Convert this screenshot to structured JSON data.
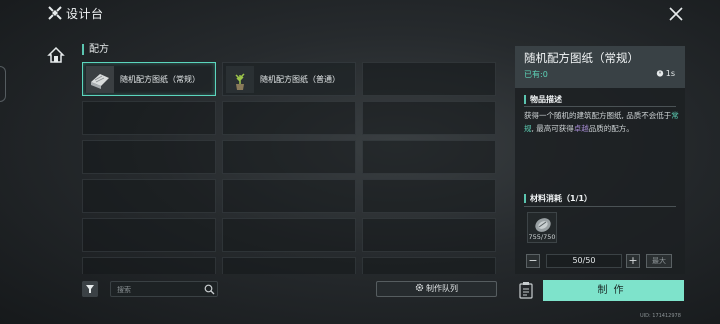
{
  "header": {
    "title": "设计台",
    "logo_icon": "crossed-tools-icon",
    "close_icon": "close-icon"
  },
  "nav": {
    "home_icon": "house-icon"
  },
  "section": {
    "title": "配方"
  },
  "recipes": [
    {
      "label": "随机配方图纸（常规）",
      "selected": true,
      "icon": "blueprint-icon"
    },
    {
      "label": "随机配方图纸（普通）",
      "selected": false,
      "icon": "potted-plant-icon"
    }
  ],
  "grid_slots": {
    "columns": 3,
    "rows": 6
  },
  "toolbar": {
    "filter_icon": "funnel-icon",
    "search_placeholder": "搜索",
    "search_icon": "magnifier-icon",
    "queue_label": "制作队列",
    "queue_icon": "gear-icon"
  },
  "detail": {
    "item_name": "随机配方图纸（常规）",
    "owned": "已有:0",
    "time": "1s",
    "desc_title": "物品描述",
    "desc_parts": [
      "获得一个随机的建筑配方图纸, 品质不会低于",
      "常规",
      ", 最高可获得",
      "卓越",
      "品质的配方。"
    ],
    "materials_title": "材料消耗（1/1）",
    "material": {
      "count": "755/750",
      "icon": "metal-ore-icon"
    },
    "quantity": "50/50",
    "minus_label": "−",
    "plus_label": "+",
    "max_label": "最大",
    "recycle_icon": "recycle-bin-icon",
    "craft_label": "制作"
  },
  "footer": {
    "uid": "UID: 171412978"
  },
  "colors": {
    "accent": "#5dd3b8",
    "craft_button": "#7ee3cb",
    "rare": "#a48ad0"
  }
}
